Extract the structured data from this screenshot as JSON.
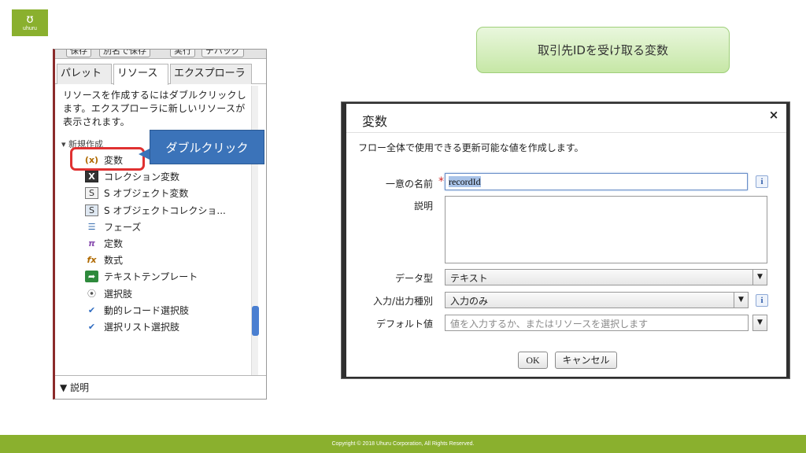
{
  "brand": {
    "logo_glyph": "ʊ",
    "logo_text": "uhuru",
    "color": "#8ab02e"
  },
  "slide_title": "取引先IDを受け取る変数",
  "callout": "ダブルクリック",
  "left_panel": {
    "toolbar": [
      "保存",
      "別名で保存",
      "実行",
      "デバッグ"
    ],
    "tabs": [
      {
        "label": "パレット",
        "active": false
      },
      {
        "label": "リソース",
        "active": true
      },
      {
        "label": "エクスプローラ",
        "active": false
      }
    ],
    "description": "リソースを作成するにはダブルクリックします。エクスプローラに新しいリソースが表示されます。",
    "section_header": "▾ 新規作成",
    "items": [
      {
        "label": "変数",
        "icon": "variable-icon",
        "glyph": "(x)"
      },
      {
        "label": "コレクション変数",
        "icon": "collection-variable-icon",
        "glyph": "X"
      },
      {
        "label": "S オブジェクト変数",
        "icon": "sobject-variable-icon",
        "glyph": "S"
      },
      {
        "label": "S オブジェクトコレクショ...",
        "icon": "sobject-collection-icon",
        "glyph": "S"
      },
      {
        "label": "フェーズ",
        "icon": "stage-icon",
        "glyph": "☰"
      },
      {
        "label": "定数",
        "icon": "constant-pi-icon",
        "glyph": "π"
      },
      {
        "label": "数式",
        "icon": "formula-fx-icon",
        "glyph": "fx"
      },
      {
        "label": "テキストテンプレート",
        "icon": "text-template-icon",
        "glyph": "➦"
      },
      {
        "label": "選択肢",
        "icon": "choice-icon",
        "glyph": "⦿"
      },
      {
        "label": "動的レコード選択肢",
        "icon": "dynamic-choice-icon",
        "glyph": "✔"
      },
      {
        "label": "選択リスト選択肢",
        "icon": "picklist-choice-icon",
        "glyph": "✔"
      }
    ],
    "bottom_section": "▼ 説明"
  },
  "dialog": {
    "title": "変数",
    "close_glyph": "×",
    "description": "フロー全体で使用できる更新可能な値を作成します。",
    "fields": {
      "unique_name_label": "一意の名前",
      "unique_name_value": "recordId",
      "required_mark": "*",
      "description_label": "説明",
      "data_type_label": "データ型",
      "data_type_value": "テキスト",
      "io_type_label": "入力/出力種別",
      "io_type_value": "入力のみ",
      "default_label": "デフォルト値",
      "default_placeholder": "値を入力するか、またはリソースを選択します"
    },
    "info_glyph": "i",
    "dropdown_glyph": "▼",
    "ok_label": "OK",
    "cancel_label": "キャンセル"
  },
  "footer": "Copyright © 2018 Uhuru Corporation, All Rights Reserved."
}
